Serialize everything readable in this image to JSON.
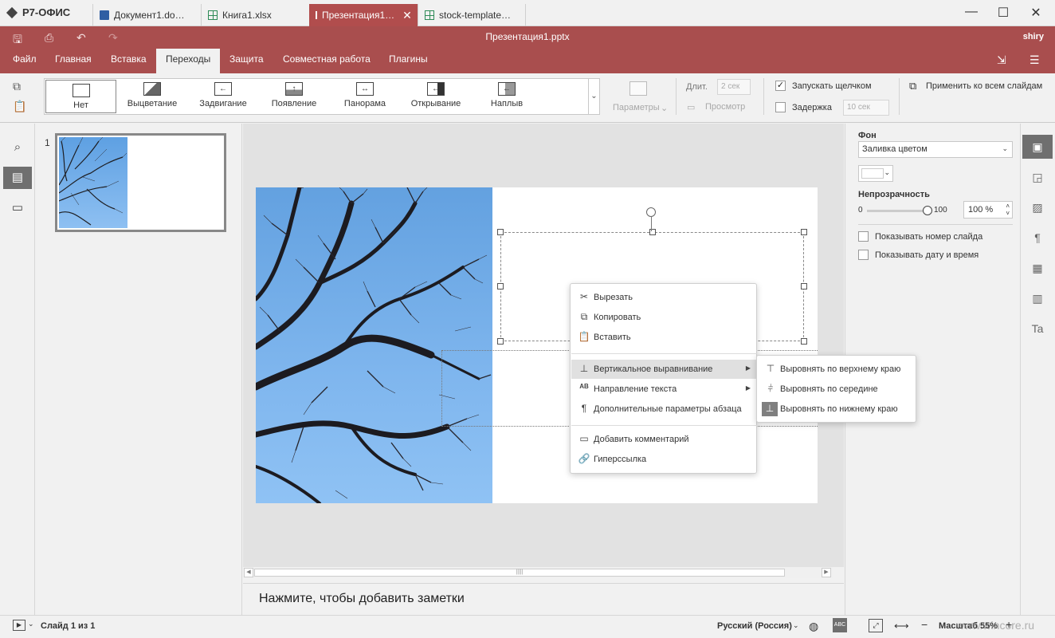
{
  "app": {
    "name": "Р7-ОФИС"
  },
  "tabs": [
    {
      "label": "Документ1.do…",
      "type": "doc"
    },
    {
      "label": "Книга1.xlsx",
      "type": "xls"
    },
    {
      "label": "Презентация1…",
      "type": "ppt"
    },
    {
      "label": "stock-template…",
      "type": "xls"
    }
  ],
  "header": {
    "title": "Презентация1.pptx",
    "user": "shiry"
  },
  "menu": [
    "Файл",
    "Главная",
    "Вставка",
    "Переходы",
    "Защита",
    "Совместная работа",
    "Плагины"
  ],
  "transitions": [
    {
      "label": "Нет",
      "icon": "none"
    },
    {
      "label": "Выцветание",
      "icon": "fade"
    },
    {
      "label": "Задвигание",
      "icon": "push"
    },
    {
      "label": "Появление",
      "icon": "wipe"
    },
    {
      "label": "Панорама",
      "icon": "split"
    },
    {
      "label": "Открывание",
      "icon": "uncover"
    },
    {
      "label": "Наплыв",
      "icon": "cover"
    }
  ],
  "toolbar": {
    "params": "Параметры",
    "duration_label": "Длит.",
    "duration_value": "2 сек",
    "preview": "Просмотр",
    "start_on_click": "Запускать щелчком",
    "start_on_click_checked": true,
    "delay": "Задержка",
    "delay_value": "10 сек",
    "apply_all": "Применить ко всем слайдам"
  },
  "slides": {
    "number": "1"
  },
  "notes": {
    "placeholder": "Нажмите, чтобы добавить заметки"
  },
  "right_panel": {
    "background_label": "Фон",
    "fill_value": "Заливка цветом",
    "opacity_label": "Непрозрачность",
    "slider_min": "0",
    "slider_max": "100",
    "opacity_value": "100 %",
    "opacity_level": 1.0,
    "show_slide_number": "Показывать номер слайда",
    "show_date_time": "Показывать дату и время"
  },
  "context_menu": {
    "items": [
      "Вырезать",
      "Копировать",
      "Вставить",
      "Вертикальное выравнивание",
      "Направление текста",
      "Дополнительные параметры абзаца",
      "Добавить комментарий",
      "Гиперссылка"
    ],
    "submenu": [
      "Выровнять по верхнему краю",
      "Выровнять по середине",
      "Выровнять по нижнему краю"
    ]
  },
  "status": {
    "slide_info": "Слайд 1 из 1",
    "language": "Русский (Россия)",
    "zoom": "Масштаб 55%",
    "watermark": "www.wincore.ru"
  },
  "colors": {
    "accent": "#a94e4e",
    "active_tab": "#b14d4d"
  }
}
